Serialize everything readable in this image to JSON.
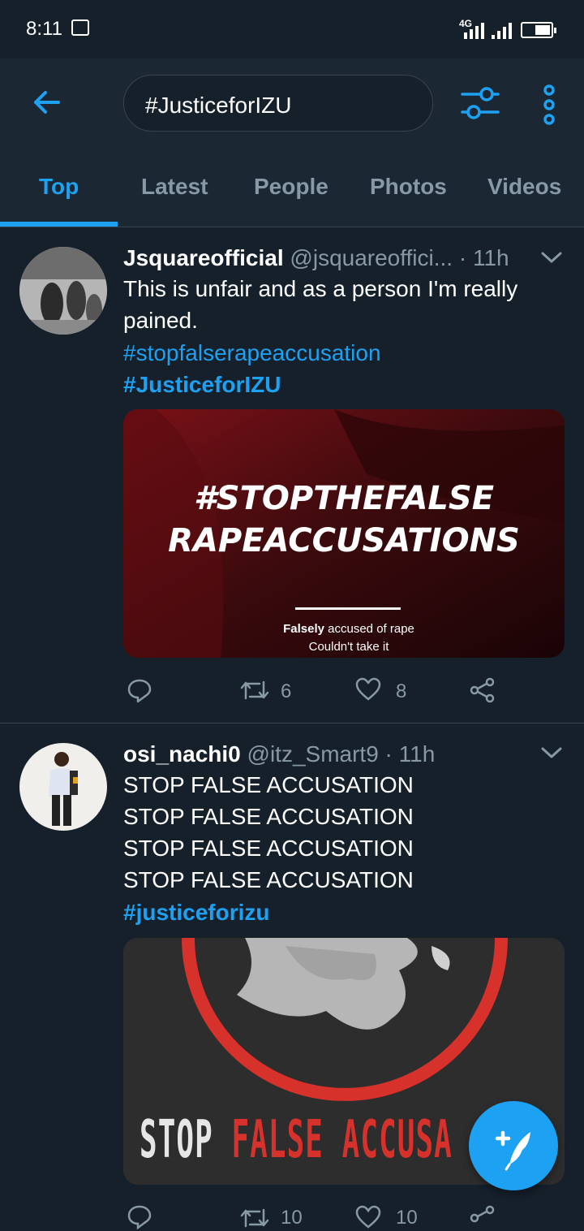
{
  "status_bar": {
    "time": "8:11",
    "network": "4G"
  },
  "search": {
    "query": "#JusticeforIZU"
  },
  "tabs": [
    "Top",
    "Latest",
    "People",
    "Photos",
    "Videos"
  ],
  "active_tab": "Top",
  "tweets": [
    {
      "name": "Jsquareofficial",
      "handle": "@jsquareoffici...",
      "time": "· 11h",
      "text": "This is unfair and as a person I'm really\npained.",
      "hashtags": [
        "#stopfalserapeaccusation",
        "#JusticeforIZU"
      ],
      "media": {
        "headline_line1": "#STOPTHEFALSE",
        "headline_line2": "RAPEACCUSATIONS",
        "caption_bold": "Falsely",
        "caption_rest": " accused of rape",
        "caption_line2": "Couldn't take it"
      },
      "retweets": "6",
      "likes": "8"
    },
    {
      "name": "osi_nachi0",
      "handle": "@itz_Smart9",
      "time": "· 11h",
      "text": "STOP FALSE ACCUSATION\nSTOP FALSE ACCUSATION\nSTOP FALSE ACCUSATION\nSTOP FALSE ACCUSATION",
      "hashtags": [
        "#justiceforizu"
      ],
      "media": {
        "word1": "STOP",
        "word2": "FALSE",
        "word3": "ACCUSA"
      },
      "retweets": "10",
      "likes": "10"
    }
  ],
  "colors": {
    "accent": "#1da1f2",
    "background": "#15202b",
    "header": "#1b2733",
    "muted": "#8899a6"
  }
}
